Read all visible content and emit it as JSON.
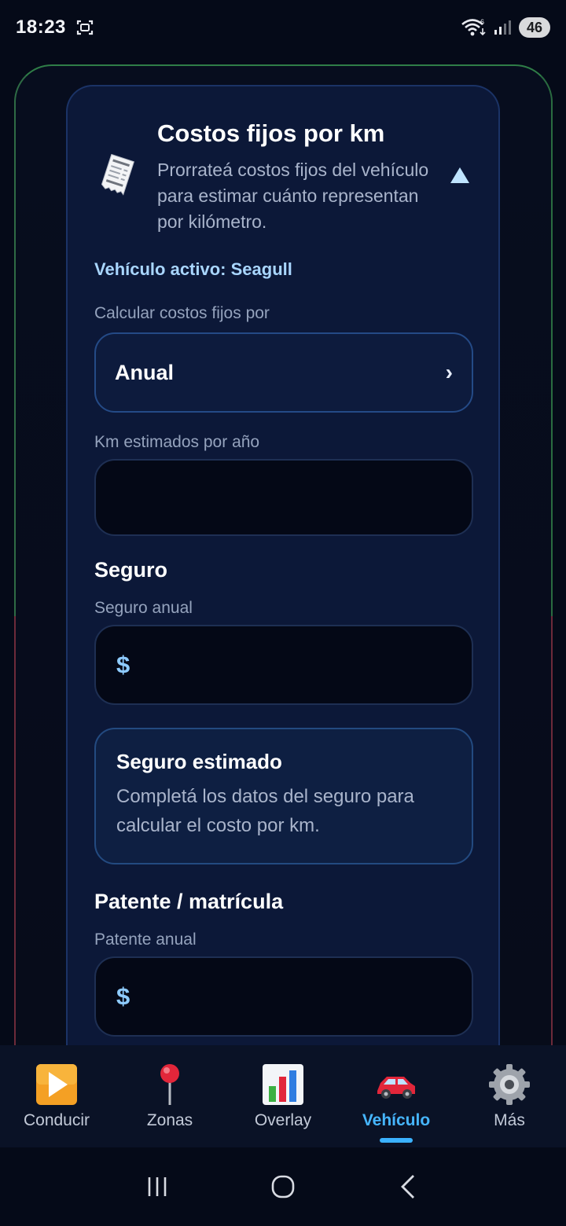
{
  "status_bar": {
    "time": "18:23",
    "battery": "46",
    "wifi_badge": "6"
  },
  "card": {
    "title": "Costos fijos por km",
    "description": "Prorrateá costos fijos del vehículo para estimar cuánto representan por kilómetro.",
    "active_vehicle": "Vehículo activo: Seagull",
    "calc_label": "Calcular costos fijos por",
    "calc_value": "Anual",
    "km_label": "Km estimados por año",
    "km_value": "",
    "insurance_section": "Seguro",
    "insurance_label": "Seguro anual",
    "insurance_currency": "$",
    "estimate_title": "Seguro estimado",
    "estimate_text": "Completá los datos del seguro para calcular el costo por km.",
    "plate_section": "Patente / matrícula",
    "plate_label": "Patente anual",
    "plate_currency": "$"
  },
  "bottom_nav": {
    "items": [
      {
        "label": "Conducir",
        "icon": "play-button-icon"
      },
      {
        "label": "Zonas",
        "icon": "pin-icon"
      },
      {
        "label": "Overlay",
        "icon": "bar-chart-icon"
      },
      {
        "label": "Vehículo",
        "icon": "car-icon",
        "active": true
      },
      {
        "label": "Más",
        "icon": "gear-icon"
      }
    ]
  },
  "colors": {
    "background": "#050a18",
    "card": "#0c1838",
    "accent": "#3bb2ff",
    "active_vehicle_text": "#a9d6ff"
  }
}
